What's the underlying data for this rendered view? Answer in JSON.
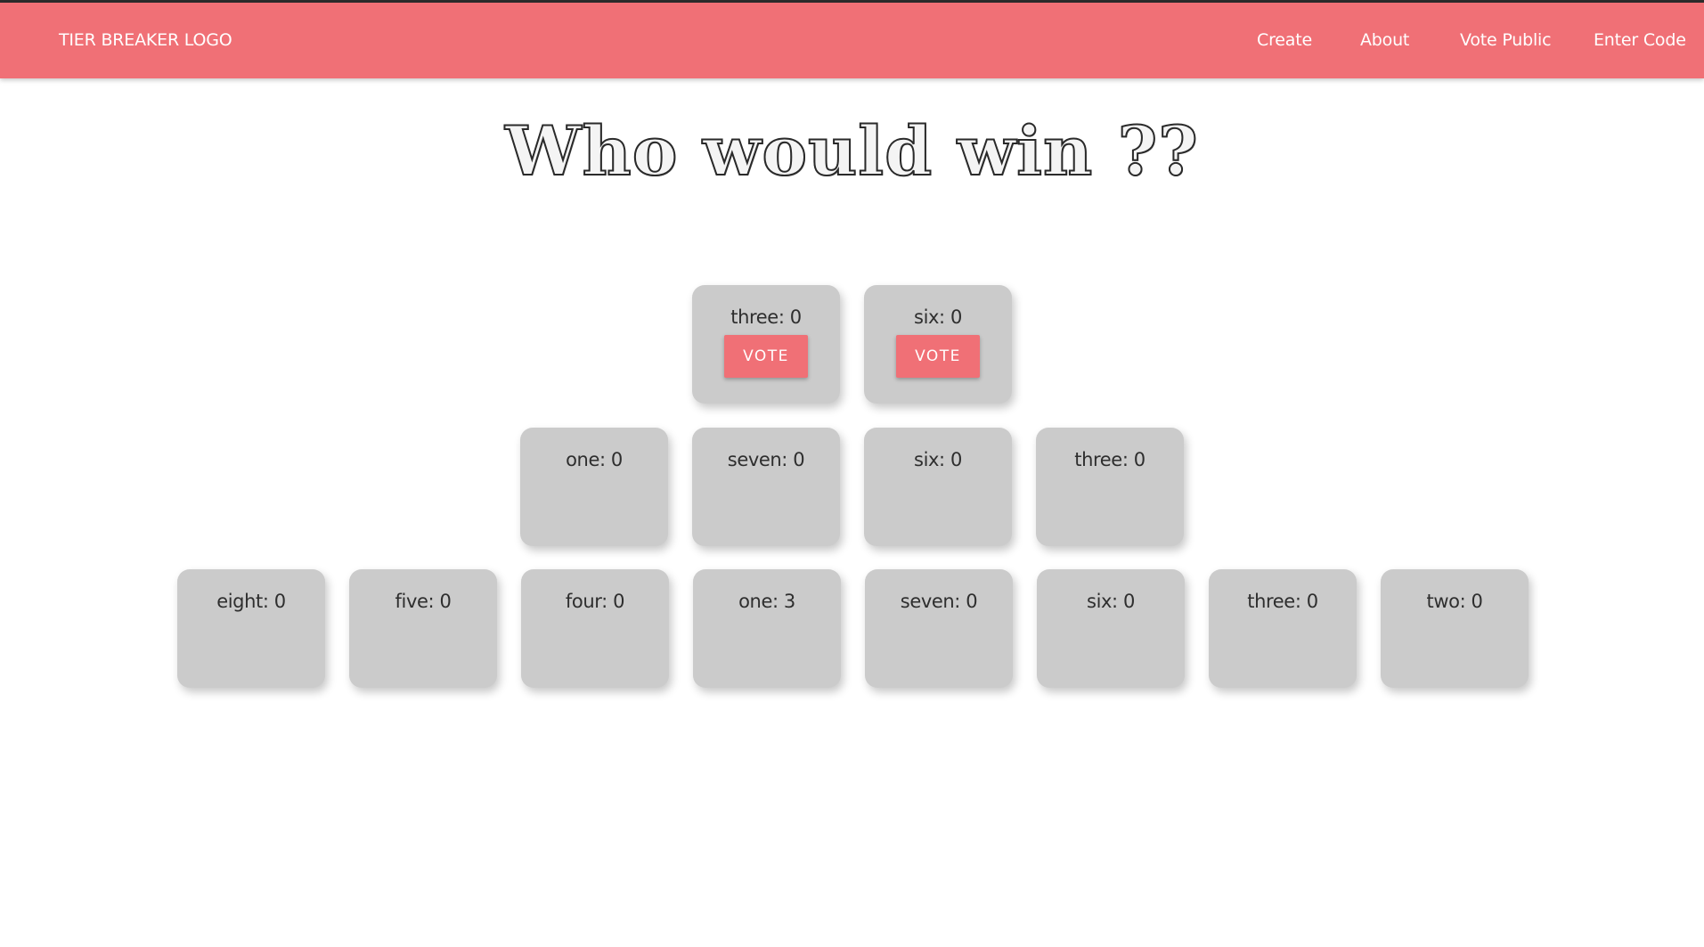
{
  "navbar": {
    "logo": "TIER BREAKER LOGO",
    "links": [
      "Create",
      "About",
      "Vote Public",
      "Enter Code"
    ],
    "color": "#f07076"
  },
  "title": "Who would win ??",
  "vote_label": "VOTE",
  "bracket": {
    "final": [
      {
        "label": "three: 0"
      },
      {
        "label": "six: 0"
      }
    ],
    "semifinal": [
      {
        "label": "one: 0"
      },
      {
        "label": "seven: 0"
      },
      {
        "label": "six: 0"
      },
      {
        "label": "three: 0"
      }
    ],
    "round1": [
      {
        "label": "eight: 0"
      },
      {
        "label": "five: 0"
      },
      {
        "label": "four: 0"
      },
      {
        "label": "one: 3"
      },
      {
        "label": "seven: 0"
      },
      {
        "label": "six: 0"
      },
      {
        "label": "three: 0"
      },
      {
        "label": "two: 0"
      }
    ]
  }
}
